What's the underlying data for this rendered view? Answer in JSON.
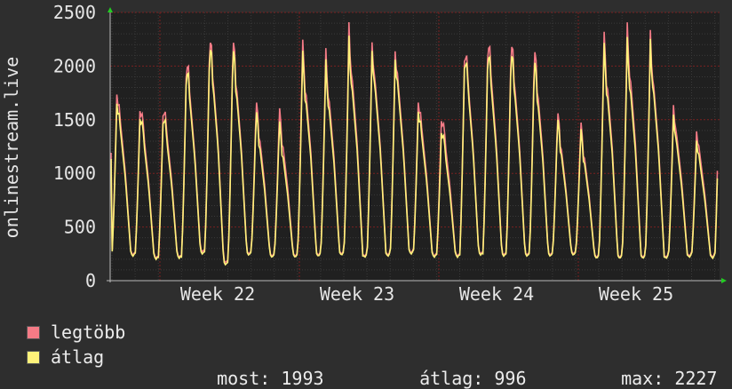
{
  "chart_data": {
    "type": "line",
    "ylabel": "onlinestream.live",
    "ylim": [
      0,
      2500
    ],
    "yticks": [
      0,
      500,
      1000,
      1500,
      2000,
      2500
    ],
    "xtick_labels": [
      "Week 22",
      "Week 23",
      "Week 24",
      "Week 25"
    ],
    "grid": true,
    "colors": {
      "background": "#2e2e2e",
      "plot_background": "#202020",
      "grid": "#7a2020",
      "legtobb": "#f47b86",
      "atlag": "#fff27a",
      "axis_arrow": "#22cc22"
    },
    "series": [
      {
        "name": "legtöbb",
        "daily_peaks": [
          1820,
          1690,
          1680,
          2110,
          2300,
          2250,
          1650,
          1570,
          2170,
          2080,
          2310,
          2240,
          2200,
          1740,
          1590,
          2240,
          2300,
          2260,
          2160,
          1550,
          1440,
          2240,
          2310,
          2240,
          1650,
          1430,
          2160
        ],
        "daily_mins": [
          250,
          220,
          230,
          280,
          180,
          260,
          240,
          240,
          250,
          260,
          240,
          250,
          270,
          240,
          240,
          260,
          250,
          250,
          250,
          260,
          230,
          230,
          230,
          230,
          240,
          230
        ]
      },
      {
        "name": "átlag",
        "daily_peaks": [
          1730,
          1610,
          1600,
          2040,
          2230,
          2170,
          1560,
          1450,
          2070,
          1980,
          2190,
          2160,
          2120,
          1650,
          1470,
          2170,
          2200,
          2170,
          2060,
          1490,
          1380,
          2140,
          2180,
          2160,
          1560,
          1340,
          2000
        ],
        "daily_mins": [
          240,
          210,
          220,
          260,
          160,
          250,
          230,
          230,
          240,
          250,
          230,
          240,
          260,
          230,
          230,
          250,
          240,
          240,
          240,
          250,
          220,
          220,
          220,
          220,
          230,
          220
        ]
      }
    ]
  },
  "legend": {
    "legtobb_label": "legtöbb",
    "atlag_label": "átlag"
  },
  "stats": {
    "most_label": "most:",
    "most_value": "1993",
    "atlag_label": "átlag:",
    "atlag_value": "996",
    "max_label": "max:",
    "max_value": "2227"
  }
}
